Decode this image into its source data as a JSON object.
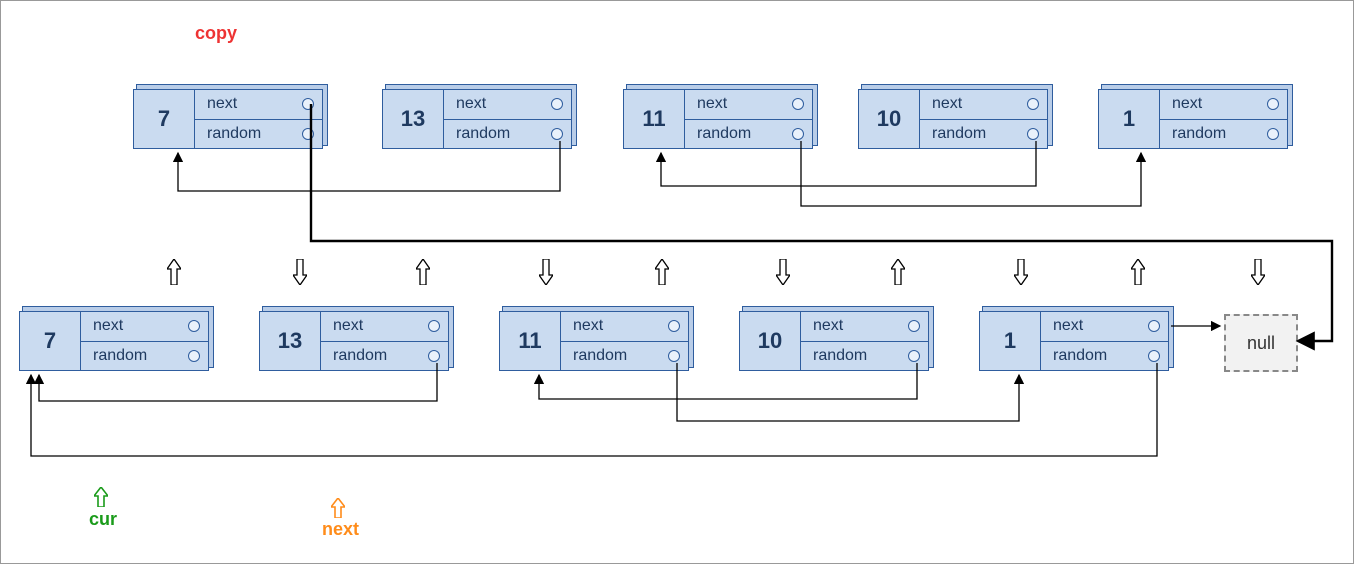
{
  "labels": {
    "copy": "copy",
    "cur": "cur",
    "next": "next",
    "null": "null",
    "field_next": "next",
    "field_random": "random"
  },
  "colors": {
    "copy_label": "#e33",
    "cur_label": "#1a9b1a",
    "next_label": "#ff8c1a",
    "node_fill": "#cadbf0",
    "node_border": "#2f5d9e",
    "arrow": "#000"
  },
  "top_nodes": [
    {
      "value": 7
    },
    {
      "value": 13
    },
    {
      "value": 11
    },
    {
      "value": 10
    },
    {
      "value": 1
    }
  ],
  "bottom_nodes": [
    {
      "value": 7
    },
    {
      "value": 13
    },
    {
      "value": 11
    },
    {
      "value": 10
    },
    {
      "value": 1
    }
  ],
  "top_random_connections": [
    {
      "from": 1,
      "to": 0,
      "note": "top 13.random -> top 7"
    },
    {
      "from": 2,
      "to": 4,
      "note": "top 11.random -> top 1"
    },
    {
      "from": 3,
      "to": 2,
      "note": "top 10.random -> top 11"
    }
  ],
  "bottom_random_connections": [
    {
      "from": 1,
      "to": 0,
      "note": "bottom 13.random -> bottom 7"
    },
    {
      "from": 2,
      "to": 4,
      "note": "bottom 11.random -> bottom 1"
    },
    {
      "from": 3,
      "to": 2,
      "note": "bottom 10.random -> bottom 11"
    },
    {
      "from": 4,
      "to": 0,
      "note": "bottom 1.random -> bottom 7"
    }
  ],
  "crossing_next": {
    "from_top_node": 0,
    "to": "bottom-null",
    "note": "top 7.next -> bottom null"
  },
  "pointers": {
    "cur": {
      "target": "bottom-node-0"
    },
    "next": {
      "target": "bottom-node-1"
    }
  }
}
